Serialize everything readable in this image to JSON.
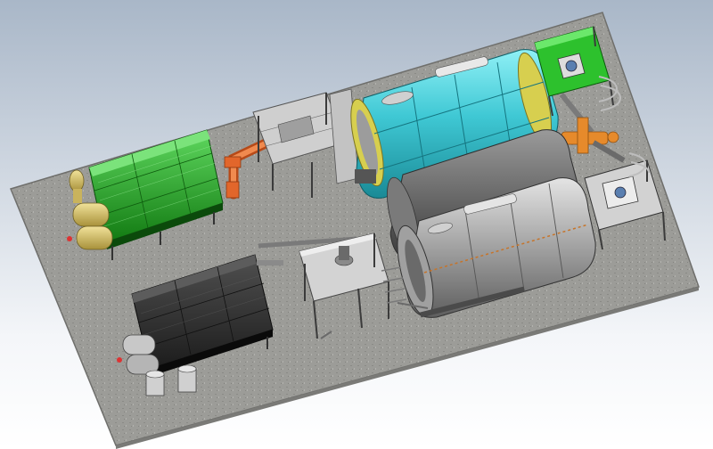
{
  "viewport": {
    "background_top": "#a9b7c8",
    "background_bottom": "#ffffff"
  },
  "colors": {
    "floor": "#9a9a96",
    "floor_edge": "#6f6f6c",
    "green_condenser": "#1f9a1f",
    "green_condenser_light": "#4cc84c",
    "cyan_reactor": "#36c2cf",
    "cyan_reactor_light": "#7fe6ef",
    "grey_reactor": "#8f8f8f",
    "grey_reactor_light": "#c9c9c9",
    "dark_condenser": "#2b2b2b",
    "orange_pipe": "#e2662b",
    "tank_yellow": "#d8c36a",
    "frame_steel": "#bcbcbc",
    "green_box": "#2dc12d"
  },
  "scene_objects": [
    {
      "name": "floor-slab"
    },
    {
      "name": "green-condenser-unit"
    },
    {
      "name": "yellow-oil-tanks"
    },
    {
      "name": "orange-feed-pipe"
    },
    {
      "name": "feeder-platform"
    },
    {
      "name": "cyan-reactor"
    },
    {
      "name": "grey-reactor-middle"
    },
    {
      "name": "grey-reactor-front"
    },
    {
      "name": "green-furnace-box"
    },
    {
      "name": "furnace-box-right"
    },
    {
      "name": "dark-condenser-unit"
    },
    {
      "name": "dark-condenser-tanks"
    },
    {
      "name": "steel-platform"
    }
  ]
}
